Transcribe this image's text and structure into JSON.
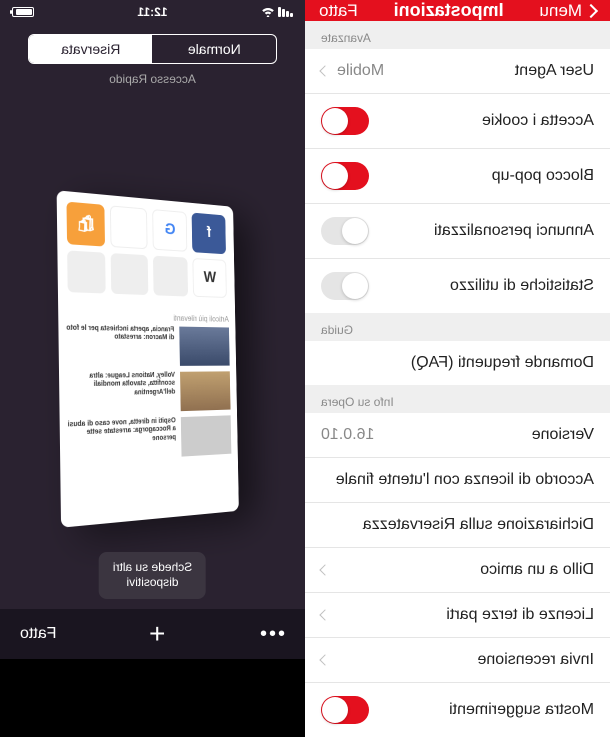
{
  "settings": {
    "header": {
      "back": "Menu",
      "title": "Impostazioni",
      "done": "Fatto"
    },
    "sections": {
      "advanced": {
        "label": "Avanzate",
        "userAgent": {
          "label": "User Agent",
          "value": "Mobile"
        },
        "cookies": {
          "label": "Accetta i cookie",
          "on": true
        },
        "popup": {
          "label": "Blocco pop-up",
          "on": true
        },
        "ads": {
          "label": "Annunci personalizzati",
          "on": false
        },
        "stats": {
          "label": "Statistiche di utilizzo",
          "on": false
        }
      },
      "help": {
        "label": "Guida",
        "faq": "Domande frequenti (FAQ)"
      },
      "about": {
        "label": "Info su Opera",
        "version": {
          "label": "Versione",
          "value": "16.0.10"
        },
        "eula": "Accordo di licenza con l'utente finale",
        "privacy": "Dichiarazione sulla Riservatezza",
        "tell": "Dillo a un amico",
        "licenses": "Licenze di terze parti",
        "review": "Invia recensione",
        "tips": {
          "label": "Mostra suggerimenti",
          "on": true
        }
      }
    }
  },
  "tabs": {
    "time": "12:11",
    "seg": {
      "normal": "Normale",
      "private": "Riservata"
    },
    "quickAccess": "Accesso Rapido",
    "otherDevices": "Schede su altri\ndispositivi",
    "bottom": {
      "done": "Fatto"
    },
    "card": {
      "sectionTop": "Articoli più rilevanti",
      "news1": "Francia, aperta inchiesta per le foto di Macron: arrestato",
      "news2": "Volley, Nations League: altra sconfitta, stavolta mondiali dell'Argentina",
      "news3": "Ospiti in diretta, nove caso di abusi a Roccagorga: arrestate sette persone"
    }
  }
}
